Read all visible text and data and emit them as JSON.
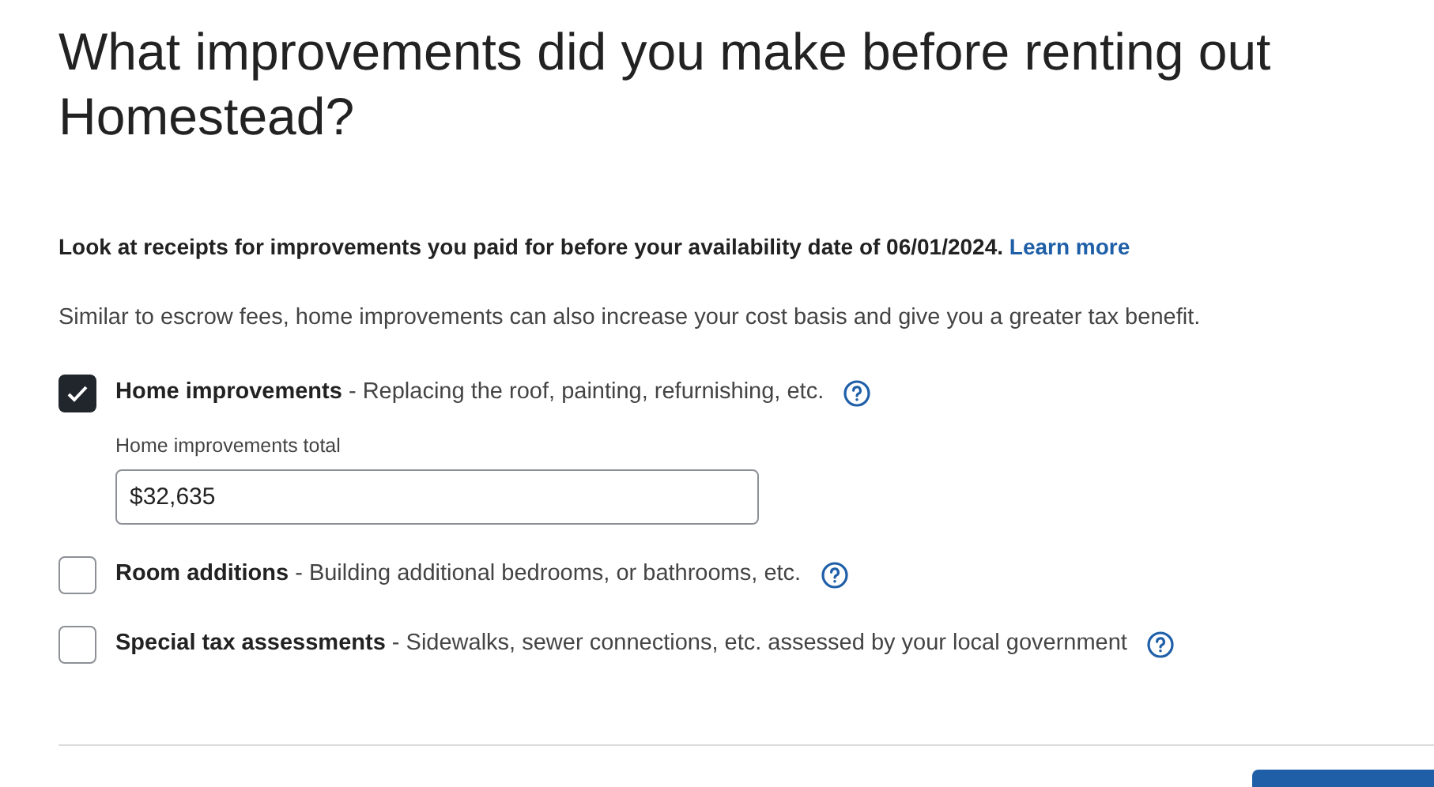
{
  "title": "What improvements did you make before renting out Homestead?",
  "instruction": {
    "text": "Look at receipts for improvements you paid for before your availability date of 06/01/2024.",
    "link": "Learn more"
  },
  "description": "Similar to escrow fees, home improvements can also increase your cost basis and give you a greater tax benefit.",
  "options": [
    {
      "title": "Home improvements",
      "detail": " - Replacing the roof, painting, refurnishing, etc.",
      "checked": true,
      "field": {
        "label": "Home improvements total",
        "value": "$32,635"
      }
    },
    {
      "title": "Room additions",
      "detail": " - Building additional bedrooms, or bathrooms, etc.",
      "checked": false
    },
    {
      "title": "Special tax assessments",
      "detail": " - Sidewalks, sewer connections, etc. assessed by your local government",
      "checked": false
    }
  ]
}
